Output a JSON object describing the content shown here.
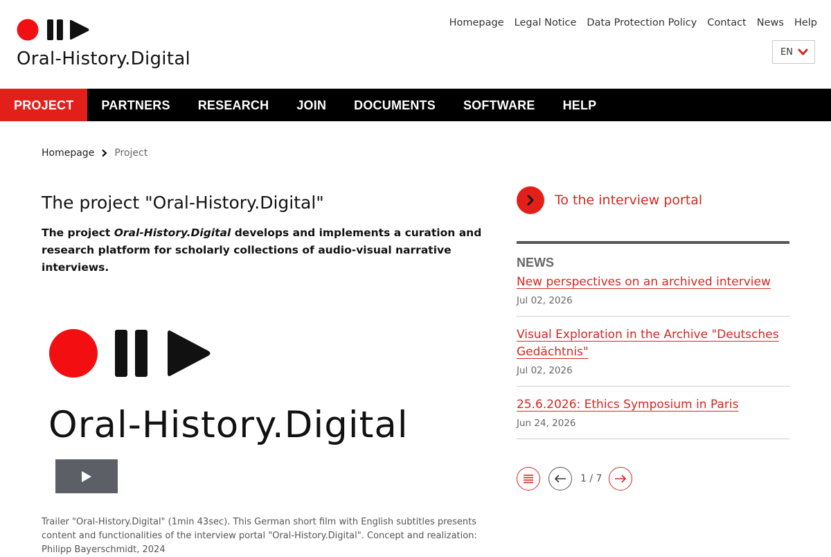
{
  "brand": {
    "name": "Oral-History.Digital",
    "colors": {
      "accent": "#e31f1a",
      "nav": "#000000"
    }
  },
  "meta_nav": [
    {
      "label": "Homepage"
    },
    {
      "label": "Legal Notice"
    },
    {
      "label": "Data Protection Policy"
    },
    {
      "label": "Contact"
    },
    {
      "label": "News"
    },
    {
      "label": "Help"
    }
  ],
  "language": {
    "selected": "EN",
    "icon": "chevron-down-icon"
  },
  "main_nav": [
    {
      "label": "PROJECT",
      "active": true
    },
    {
      "label": "PARTNERS"
    },
    {
      "label": "RESEARCH"
    },
    {
      "label": "JOIN"
    },
    {
      "label": "DOCUMENTS"
    },
    {
      "label": "SOFTWARE"
    },
    {
      "label": "HELP"
    }
  ],
  "breadcrumb": {
    "home": "Homepage",
    "current": "Project"
  },
  "main": {
    "title": "The project \"Oral-History.Digital\"",
    "intro_prefix": "The project ",
    "intro_emphasis": "Oral-History.Digital",
    "intro_suffix": " develops and implements a curation and research platform for scholarly collections of audio-visual narrative interviews.",
    "video": {
      "wordmark": "Oral-History.Digital",
      "play_icon": "play-icon"
    },
    "caption": "Trailer \"Oral-History.Digital\" (1min 43sec). This German short film with English subtitles presents content and functionalities of the interview portal \"Oral-History.Digital\". Concept and realization: Philipp Bayerschmidt, 2024"
  },
  "sidebar": {
    "portal_link": "To the interview portal",
    "news_heading": "NEWS",
    "news": [
      {
        "title": "New perspectives on an archived interview",
        "date": "Jul 02, 2026"
      },
      {
        "title": "Visual Exploration in the Archive \"Deutsches Gedächtnis\"",
        "date": "Jul 02, 2026"
      },
      {
        "title": "25.6.2026: Ethics Symposium in Paris",
        "date": "Jun 24, 2026"
      }
    ],
    "pager": {
      "current": "1",
      "separator": "/",
      "total": "7"
    }
  }
}
